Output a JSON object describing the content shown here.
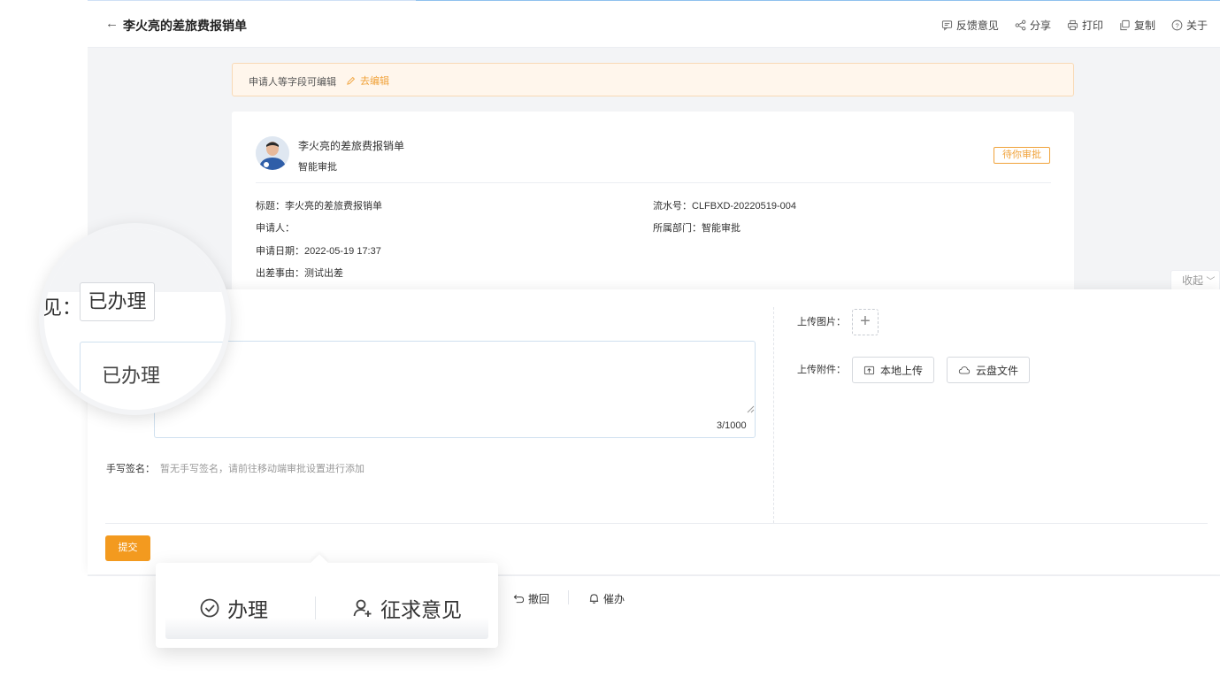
{
  "header": {
    "back_icon": "←",
    "title": "李火亮的差旅费报销单",
    "tools": [
      {
        "label": "反馈意见",
        "icon": "feedback-icon"
      },
      {
        "label": "分享",
        "icon": "share-icon"
      },
      {
        "label": "打印",
        "icon": "print-icon"
      },
      {
        "label": "复制",
        "icon": "copy-icon"
      },
      {
        "label": "关于",
        "icon": "help-icon"
      }
    ]
  },
  "notice": {
    "text": "申请人等字段可编辑",
    "edit_label": "去编辑"
  },
  "card": {
    "name": "李火亮的差旅费报销单",
    "sub": "智能审批",
    "status": "待你审批",
    "fields": {
      "title_key": "标题：",
      "title_val": "李火亮的差旅费报销单",
      "serial_key": "流水号：",
      "serial_val": "CLFBXD-20220519-004",
      "applicant_key": "申请人：",
      "applicant_val": "",
      "dept_key": "所属部门：",
      "dept_val": "智能审批",
      "date_key": "申请日期：",
      "date_val": "2022-05-19 17:37",
      "reason_key": "出差事由：",
      "reason_val": "测试出差"
    }
  },
  "collapse_label": "收起",
  "form": {
    "counter": "3/1000",
    "sign_label": "手写签名：",
    "sign_hint": "暂无手写签名，请前往移动端审批设置进行添加",
    "upload_image_label": "上传图片：",
    "upload_file_label": "上传附件：",
    "local_upload": "本地上传",
    "cloud_file": "云盘文件",
    "submit": "提交"
  },
  "actions": {
    "revoke": "撤回",
    "urge": "催办"
  },
  "magnifier": {
    "label": "见：",
    "chip": "已办理",
    "box_text": "已办理"
  },
  "popover": {
    "handle": "办理",
    "ask_opinion": "征求意见"
  },
  "colors": {
    "accent_orange": "#f39a1f",
    "badge_orange": "#f0a23a",
    "notice_bg": "#fff6ec"
  }
}
